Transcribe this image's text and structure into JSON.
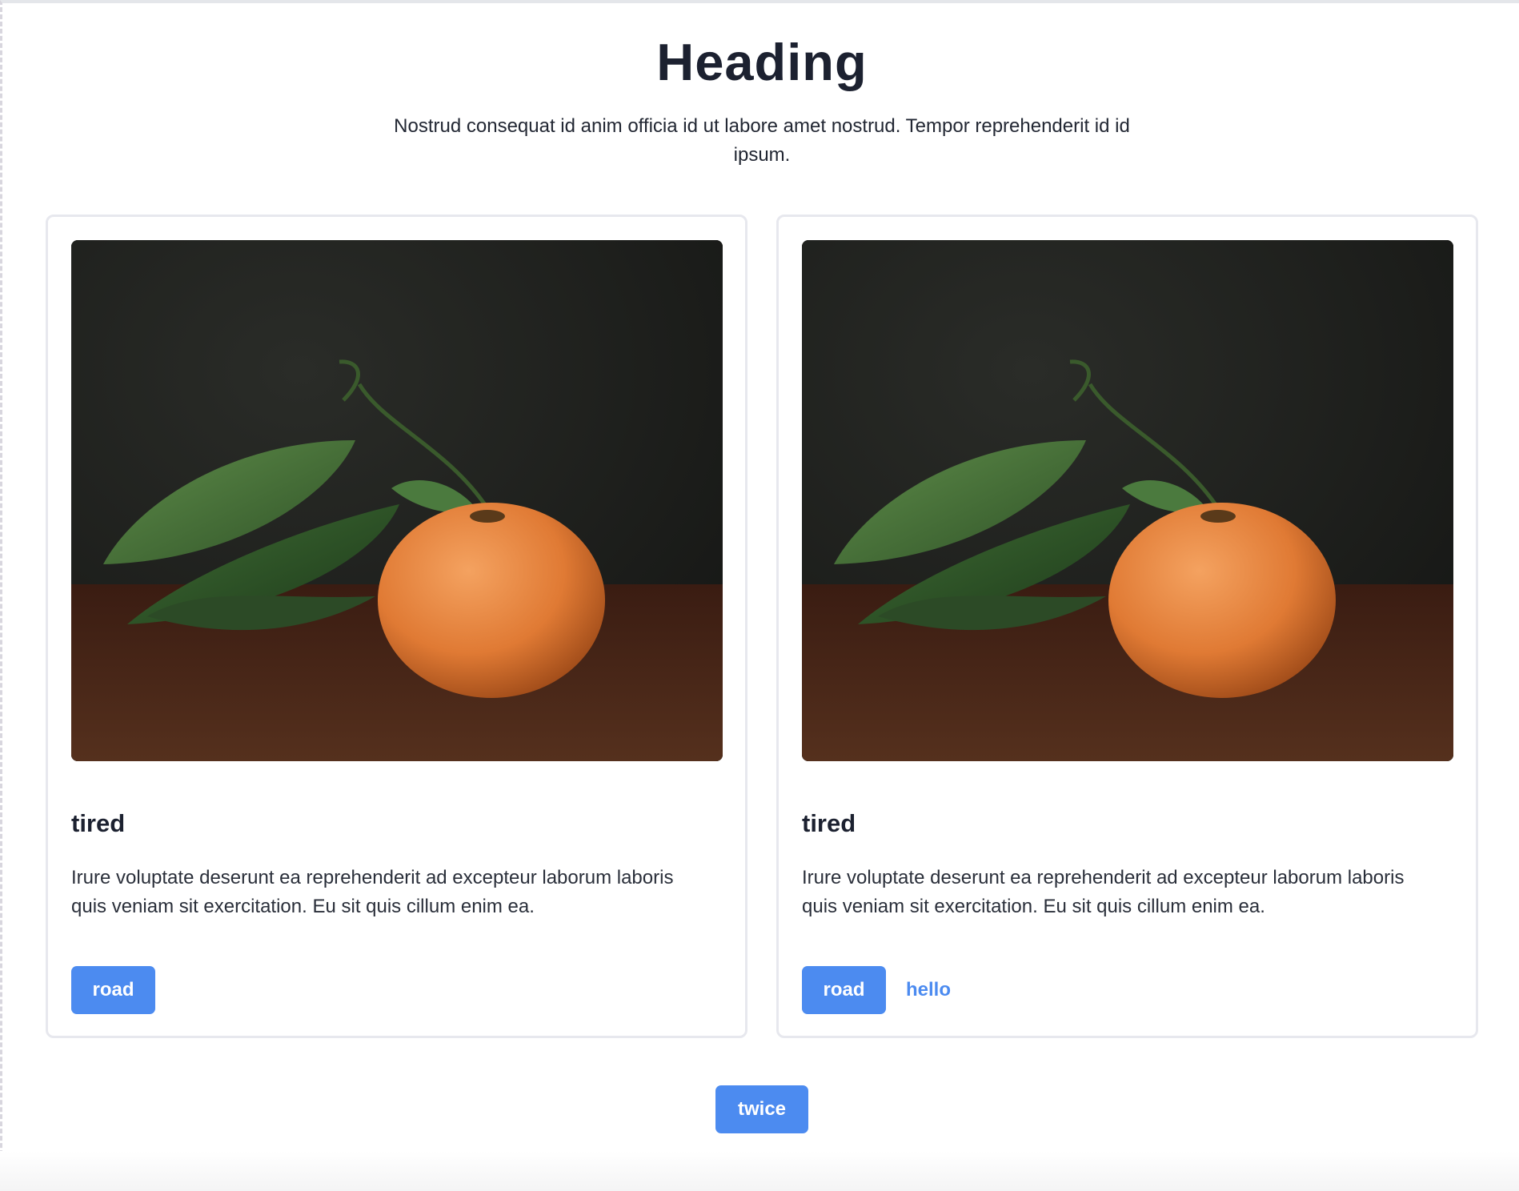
{
  "header": {
    "title": "Heading",
    "subtitle": "Nostrud consequat id anim officia id ut labore amet nostrud. Tempor reprehenderit id id ipsum."
  },
  "cards": [
    {
      "image": "orange-with-leaves-photo",
      "title": "tired",
      "text": "Irure voluptate deserunt ea reprehenderit ad excepteur laborum laboris quis veniam sit exercitation. Eu sit quis cillum enim ea.",
      "primary_label": "road"
    },
    {
      "image": "orange-with-leaves-photo",
      "title": "tired",
      "text": "Irure voluptate deserunt ea reprehenderit ad excepteur laborum laboris quis veniam sit exercitation. Eu sit quis cillum enim ea.",
      "primary_label": "road",
      "secondary_label": "hello"
    }
  ],
  "footer": {
    "button_label": "twice"
  },
  "colors": {
    "accent": "#4c8bf0",
    "text": "#1c2130",
    "card_border": "#e7e8ee"
  }
}
